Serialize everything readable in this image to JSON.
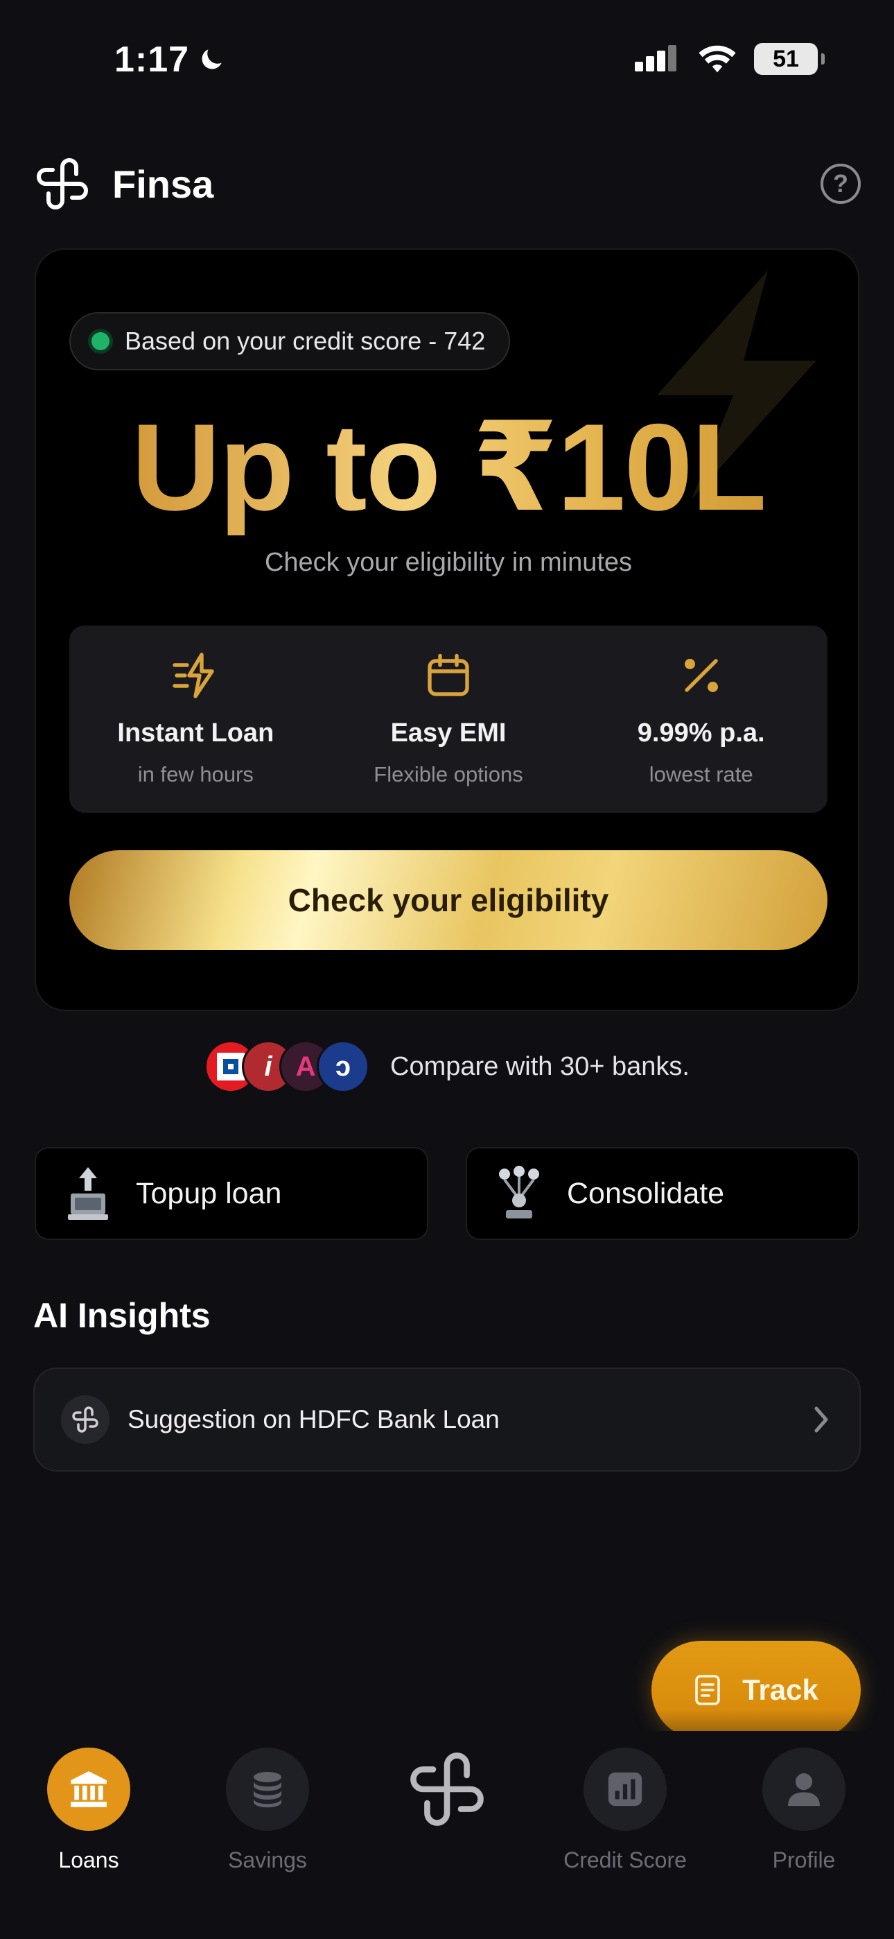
{
  "status": {
    "time": "1:17",
    "battery": "51"
  },
  "header": {
    "brand": "Finsa",
    "help": "?"
  },
  "hero": {
    "pill": "Based on your credit score - 742",
    "amount": "Up to ₹10L",
    "subtitle": "Check your eligibility in minutes",
    "features": [
      {
        "title": "Instant Loan",
        "sub": "in few hours"
      },
      {
        "title": "Easy EMI",
        "sub": "Flexible options"
      },
      {
        "title": "9.99% p.a.",
        "sub": "lowest rate"
      }
    ],
    "cta": "Check your eligibility"
  },
  "banks": {
    "text": "Compare with 30+ banks.",
    "logos": [
      "◘",
      "i",
      "A",
      "ↄ"
    ]
  },
  "actions": {
    "topup": "Topup loan",
    "consolidate": "Consolidate"
  },
  "ai": {
    "title": "AI Insights",
    "suggestion": "Suggestion on HDFC Bank Loan"
  },
  "fab": {
    "track": "Track"
  },
  "nav": {
    "loans": "Loans",
    "savings": "Savings",
    "credit": "Credit Score",
    "profile": "Profile"
  },
  "colors": {
    "accent": "#e3951a",
    "gold": "#d9a43c",
    "bg": "#0f0f13",
    "success": "#1fb36a"
  }
}
